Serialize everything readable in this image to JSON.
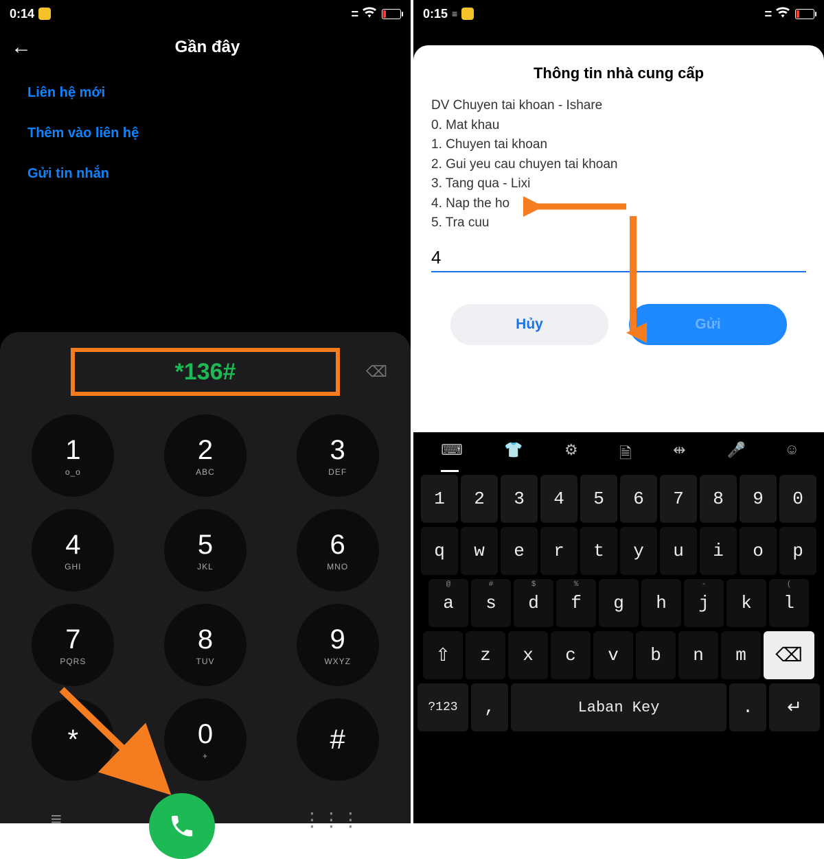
{
  "left": {
    "status": {
      "time": "0:14",
      "signal": "••••",
      "wifi": true,
      "battery_low": true
    },
    "header": {
      "title": "Gần đây"
    },
    "links": [
      "Liên hệ mới",
      "Thêm vào liên hệ",
      "Gửi tin nhắn"
    ],
    "dialed_number": "*136#",
    "keypad": [
      {
        "num": "1",
        "sub": "o_o"
      },
      {
        "num": "2",
        "sub": "ABC"
      },
      {
        "num": "3",
        "sub": "DEF"
      },
      {
        "num": "4",
        "sub": "GHI"
      },
      {
        "num": "5",
        "sub": "JKL"
      },
      {
        "num": "6",
        "sub": "MNO"
      },
      {
        "num": "7",
        "sub": "PQRS"
      },
      {
        "num": "8",
        "sub": "TUV"
      },
      {
        "num": "9",
        "sub": "WXYZ"
      },
      {
        "num": "*",
        "sub": ""
      },
      {
        "num": "0",
        "sub": "+"
      },
      {
        "num": "#",
        "sub": ""
      }
    ]
  },
  "right": {
    "status": {
      "time": "0:15"
    },
    "modal": {
      "title": "Thông tin nhà cung cấp",
      "body_lines": [
        "DV Chuyen tai khoan - Ishare",
        "0. Mat khau",
        "1. Chuyen tai khoan",
        "2. Gui yeu cau chuyen tai khoan",
        "3. Tang qua - Lixi",
        "4. Nap the ho",
        "5. Tra cuu"
      ],
      "input_value": "4",
      "cancel_label": "Hủy",
      "send_label": "Gửi"
    },
    "keyboard": {
      "numbers": [
        "1",
        "2",
        "3",
        "4",
        "5",
        "6",
        "7",
        "8",
        "9",
        "0"
      ],
      "row2": [
        "q",
        "w",
        "e",
        "r",
        "t",
        "y",
        "u",
        "i",
        "o",
        "p"
      ],
      "row3": [
        "a",
        "s",
        "d",
        "f",
        "g",
        "h",
        "j",
        "k",
        "l"
      ],
      "row3_hints": [
        "@",
        "#",
        "$",
        "%",
        "",
        "",
        "-",
        "",
        "("
      ],
      "row4": [
        "z",
        "x",
        "c",
        "v",
        "b",
        "n",
        "m"
      ],
      "sym_label": "?123",
      "space_label": "Laban Key",
      "comma": ",",
      "period": "."
    }
  },
  "colors": {
    "accent_orange": "#f57c1f",
    "accent_green": "#1db954",
    "link_blue": "#0a84ff",
    "primary_blue": "#1e88ff"
  }
}
